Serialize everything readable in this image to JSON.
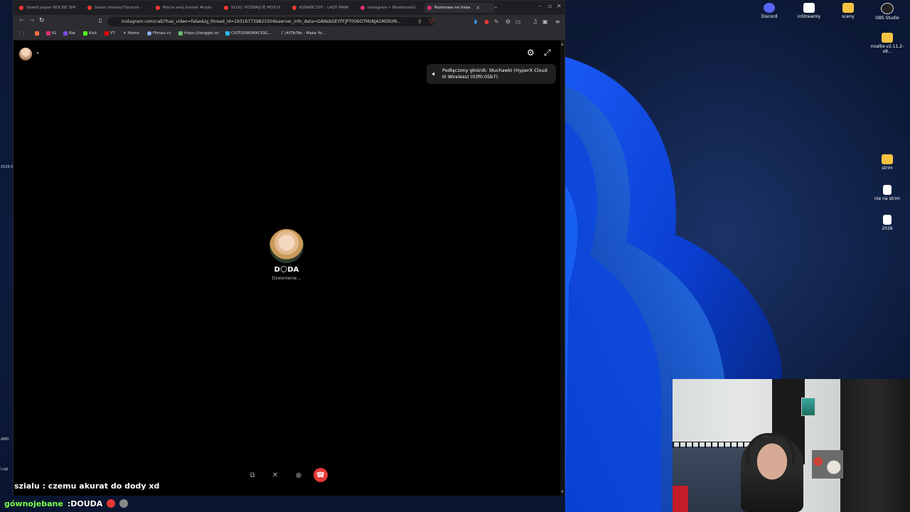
{
  "browser": {
    "tabs": [
      {
        "title": "Dawid Jasper NOCNE SPA",
        "color": "#ff3b30"
      },
      {
        "title": "Sezon zimowy!Szczyrk -",
        "color": "#ff3b30"
      },
      {
        "title": "Macie swój kontek #razo",
        "color": "#ff3b30"
      },
      {
        "title": "VLOG: POZNAJCIE MOICH",
        "color": "#ff3b30"
      },
      {
        "title": "KUBAŃCZYK - LADY PANK",
        "color": "#ff3b30"
      },
      {
        "title": "Instagram • Wiadomości",
        "color": "#e1306c"
      },
      {
        "title": "Rozmowa na Insta",
        "color": "#e1306c",
        "active": true
      }
    ],
    "new_tab": "+",
    "url": "instagram.com/call/?has_video=false&ig_thread_id=193167739823304&server_info_data=GANsbGEYFFjPT006OTMzNjA1MDEzM...",
    "bookmarks": [
      {
        "label": "IG",
        "color": "#e1306c"
      },
      {
        "label": "Rat",
        "color": "#7a4df0"
      },
      {
        "label": "Kick",
        "color": "#53fc18"
      },
      {
        "label": "YT",
        "color": "#ff0000"
      },
      {
        "label": "Home",
        "color": "#ffffff"
      },
      {
        "label": "Filman.cc",
        "color": "#8ab4f8"
      },
      {
        "label": "https://tanggle.io/",
        "color": "#66bb6a"
      },
      {
        "label": "CIOTODRON¥CIOG...",
        "color": "#29b6f6"
      },
      {
        "label": "(4)TikTok - Make Yo...",
        "color": "#ffffff"
      }
    ]
  },
  "call": {
    "speaker_notice": "Podłączony głośnik: Słuchawki (HyperX Cloud III Wireless) (03f0:05b7)",
    "callee_name": "D🌕DA",
    "callee_status": "Dzwonienie..."
  },
  "desktop": {
    "icons": [
      {
        "label": "Discord",
        "color": "#5865f2"
      },
      {
        "label": "inStreamly",
        "color": "#ffffff"
      },
      {
        "label": "sceny",
        "color": "#f6c343"
      },
      {
        "label": "OBS Studio",
        "color": "#dddddd"
      },
      {
        "label": "noalbs-v2.11.2-x8...",
        "color": "#f6c343"
      },
      {
        "label": "strim",
        "color": "#f6c343"
      },
      {
        "label": "nie na strim",
        "color": "#ffffff"
      },
      {
        "label": "2026",
        "color": "#ffffff"
      }
    ],
    "edge_labels": [
      "2026-0",
      "AMD",
      "Logi"
    ]
  },
  "chat": {
    "line1": "szialu : czemu akurat do dody  xd",
    "line2_user": "gównojebane",
    "line2_msg": ":DOUDA"
  }
}
